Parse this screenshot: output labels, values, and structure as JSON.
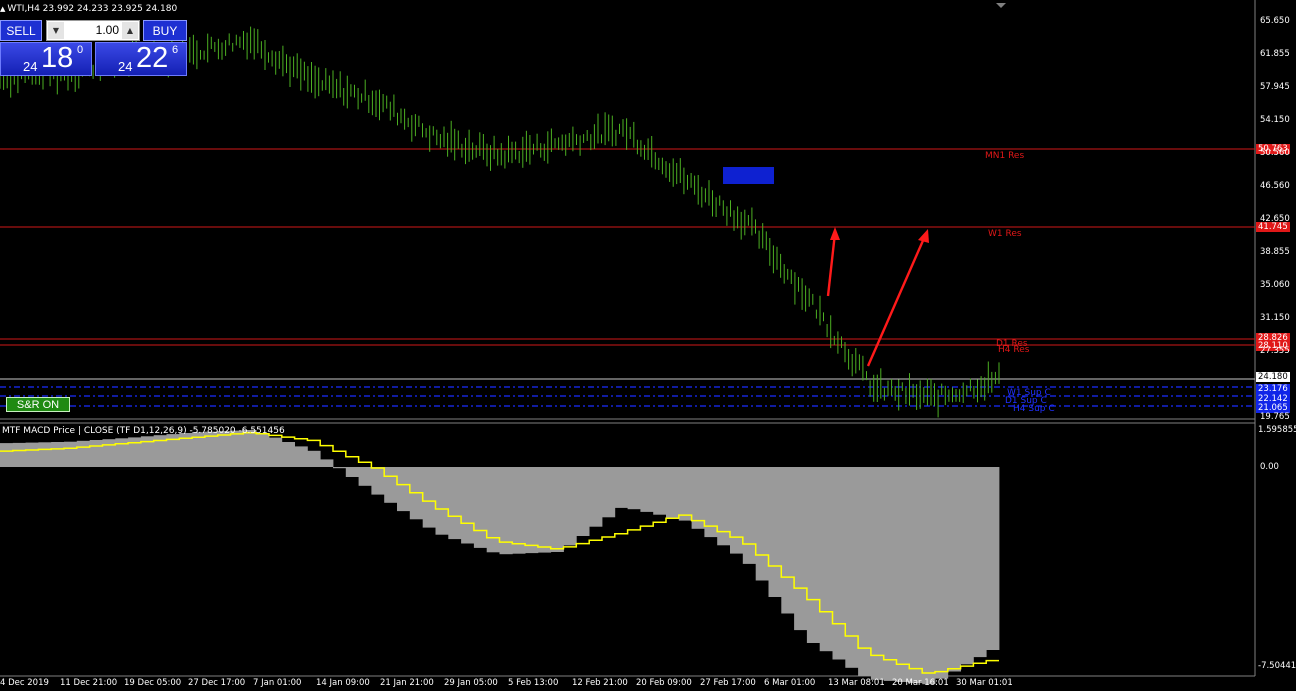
{
  "symbol_info": "WTI,H4  23.992 24.233 23.925 24.180",
  "trade_panel": {
    "sell_label": "SELL",
    "buy_label": "BUY",
    "lot_value": "1.00",
    "sell_price_small": "24",
    "sell_price_big": "18",
    "sell_price_sup": "0",
    "buy_price_small": "24",
    "buy_price_big": "22",
    "buy_price_sup": "6"
  },
  "sr_button_label": "S&R ON",
  "price_axis": [
    "65.650",
    "61.855",
    "57.945",
    "54.150",
    "50.560",
    "46.560",
    "42.650",
    "38.855",
    "35.060",
    "31.150",
    "27.355",
    "19.765"
  ],
  "price_tags": {
    "mn1": "50.763",
    "w1": "41.745",
    "d1": "28.826",
    "h4": "28.110",
    "current": "24.180",
    "sup1": "23.176",
    "sup2": "22.142",
    "sup3": "21.065"
  },
  "levels": {
    "mn1_res": "MN1 Res",
    "w1_res": "W1 Res",
    "d1_res": "D1 Res",
    "h4_res": "H4 Res",
    "w1_sup": "W1 Sup C",
    "d1_sup": "D1 Sup C",
    "h4_sup": "H4 Sup C"
  },
  "subwindow": {
    "title": "MTF MACD Price | CLOSE  (TF D1,12,26,9) -5.785020 -6.551456",
    "axis": [
      "1.595855",
      "0.00",
      "-7.504418"
    ]
  },
  "time_axis": [
    "4 Dec 2019",
    "11 Dec 21:00",
    "19 Dec 05:00",
    "27 Dec 17:00",
    "7 Jan 01:00",
    "14 Jan 09:00",
    "21 Jan 21:00",
    "29 Jan 05:00",
    "5 Feb 13:00",
    "12 Feb 21:00",
    "20 Feb 09:00",
    "27 Feb 17:00",
    "6 Mar 01:00",
    "13 Mar 08:01",
    "20 Mar 16:01",
    "30 Mar 01:01"
  ],
  "chart_data": {
    "type": "line",
    "title": "WTI,H4",
    "candle_color": "#4caf22",
    "price_line": [
      [
        "4 Dec 2019",
        59.0
      ],
      [
        "11 Dec 21:00",
        59.5
      ],
      [
        "19 Dec 05:00",
        61.0
      ],
      [
        "27 Dec 17:00",
        61.8
      ],
      [
        "7 Jan 01:00",
        63.5
      ],
      [
        "14 Jan 09:00",
        58.5
      ],
      [
        "21 Jan 21:00",
        56.5
      ],
      [
        "29 Jan 05:00",
        52.0
      ],
      [
        "5 Feb 13:00",
        50.0
      ],
      [
        "12 Feb 21:00",
        51.5
      ],
      [
        "20 Feb 09:00",
        53.0
      ],
      [
        "27 Feb 17:00",
        47.0
      ],
      [
        "6 Mar 01:00",
        42.0
      ],
      [
        "13 Mar 08:01",
        33.0
      ],
      [
        "20 Mar 16:01",
        23.0
      ],
      [
        "30 Mar 01:01",
        22.0
      ],
      [
        "latest",
        24.18
      ]
    ],
    "macd": {
      "series": [
        {
          "name": "MACD",
          "color": "#9a9a9a",
          "values": [
            0.9,
            0.95,
            1.1,
            1.3,
            1.4,
            0.6,
            -1.0,
            -2.5,
            -3.3,
            -3.2,
            -1.5,
            -2.0,
            -3.5,
            -6.5,
            -8.0,
            -8.2,
            -6.9
          ]
        },
        {
          "name": "Signal",
          "color": "#ffff00",
          "values": [
            0.6,
            0.7,
            0.9,
            1.1,
            1.3,
            1.0,
            0.0,
            -1.5,
            -2.8,
            -3.1,
            -2.5,
            -1.8,
            -2.8,
            -4.8,
            -7.0,
            -7.8,
            -7.3
          ]
        }
      ],
      "ylim": [
        -8.3,
        1.6
      ]
    },
    "ylim": [
      18.0,
      67.0
    ]
  }
}
